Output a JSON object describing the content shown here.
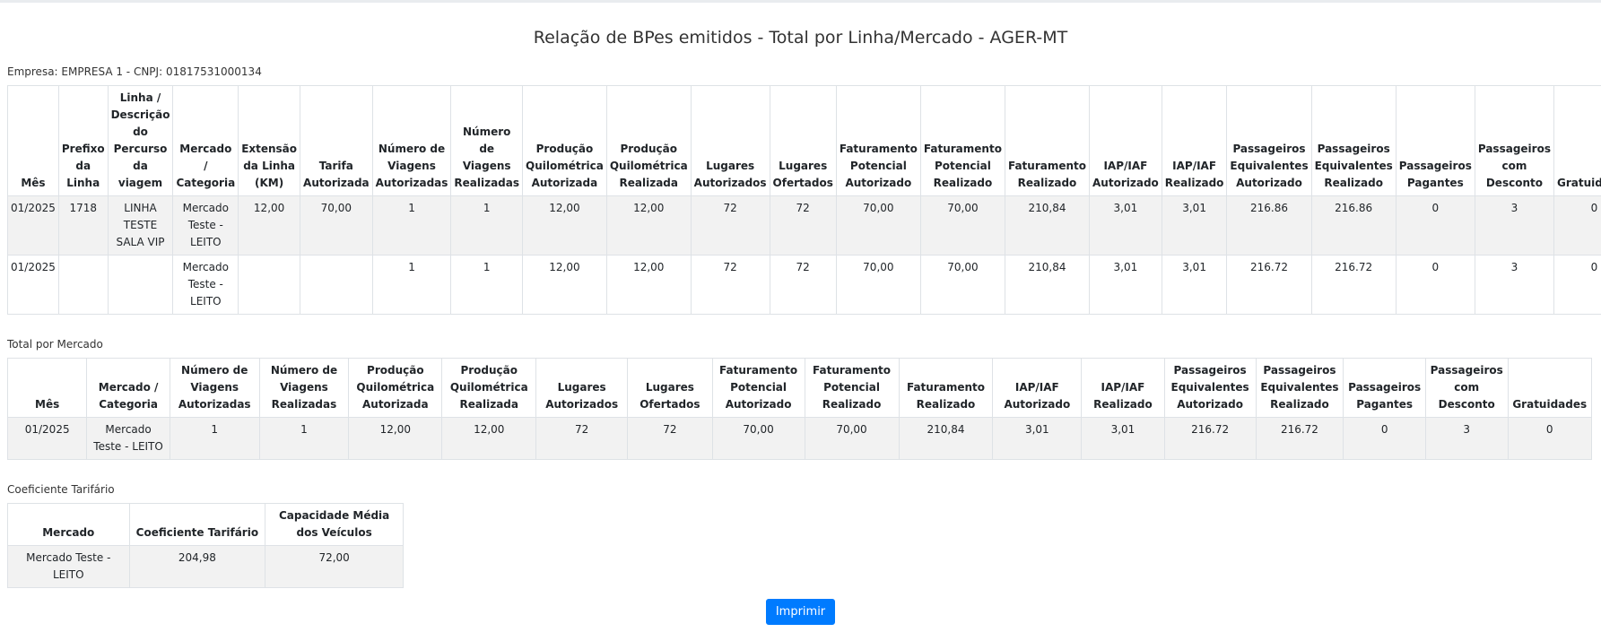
{
  "title": "Relação de BPes emitidos - Total por Linha/Mercado - AGER-MT",
  "empresa_label": "Empresa: EMPRESA 1 - CNPJ: 01817531000134",
  "main_table": {
    "headers": [
      "Mês",
      "Prefixo da Linha",
      "Linha / Descrição do Percurso da viagem",
      "Mercado / Categoria",
      "Extensão da Linha (KM)",
      "Tarifa Autorizada",
      "Número de Viagens Autorizadas",
      "Número de Viagens Realizadas",
      "Produção Quilométrica Autorizada",
      "Produção Quilométrica Realizada",
      "Lugares Autorizados",
      "Lugares Ofertados",
      "Faturamento Potencial Autorizado",
      "Faturamento Potencial Realizado",
      "Faturamento Realizado",
      "IAP/IAF Autorizado",
      "IAP/IAF Realizado",
      "Passageiros Equivalentes Autorizado",
      "Passageiros Equivalentes Realizado",
      "Passageiros Pagantes",
      "Passageiros com Desconto",
      "Gratuidades"
    ],
    "rows": [
      [
        "01/2025",
        "1718",
        "LINHA TESTE SALA VIP",
        "Mercado Teste - LEITO",
        "12,00",
        "70,00",
        "1",
        "1",
        "12,00",
        "12,00",
        "72",
        "72",
        "70,00",
        "70,00",
        "210,84",
        "3,01",
        "3,01",
        "216.86",
        "216.86",
        "0",
        "3",
        "0"
      ],
      [
        "01/2025",
        "",
        "",
        "Mercado Teste - LEITO",
        "",
        "",
        "1",
        "1",
        "12,00",
        "12,00",
        "72",
        "72",
        "70,00",
        "70,00",
        "210,84",
        "3,01",
        "3,01",
        "216.72",
        "216.72",
        "0",
        "3",
        "0"
      ]
    ]
  },
  "mercado_section": {
    "caption": "Total por Mercado",
    "headers": [
      "Mês",
      "Mercado / Categoria",
      "Número de Viagens Autorizadas",
      "Número de Viagens Realizadas",
      "Produção Quilométrica Autorizada",
      "Produção Quilométrica Realizada",
      "Lugares Autorizados",
      "Lugares Ofertados",
      "Faturamento Potencial Autorizado",
      "Faturamento Potencial Realizado",
      "Faturamento Realizado",
      "IAP/IAF Autorizado",
      "IAP/IAF Realizado",
      "Passageiros Equivalentes Autorizado",
      "Passageiros Equivalentes Realizado",
      "Passageiros Pagantes",
      "Passageiros com Desconto",
      "Gratuidades"
    ],
    "rows": [
      [
        "01/2025",
        "Mercado Teste - LEITO",
        "1",
        "1",
        "12,00",
        "12,00",
        "72",
        "72",
        "70,00",
        "70,00",
        "210,84",
        "3,01",
        "3,01",
        "216.72",
        "216.72",
        "0",
        "3",
        "0"
      ]
    ]
  },
  "coef_section": {
    "caption": "Coeficiente Tarifário",
    "headers": [
      "Mercado",
      "Coeficiente Tarifário",
      "Capacidade Média dos Veículos"
    ],
    "rows": [
      [
        "Mercado Teste - LEITO",
        "204,98",
        "72,00"
      ]
    ]
  },
  "print_button": "Imprimir",
  "colors": {
    "button": "#007bff",
    "row_stripe": "#f2f2f2",
    "border": "#dee2e6"
  }
}
